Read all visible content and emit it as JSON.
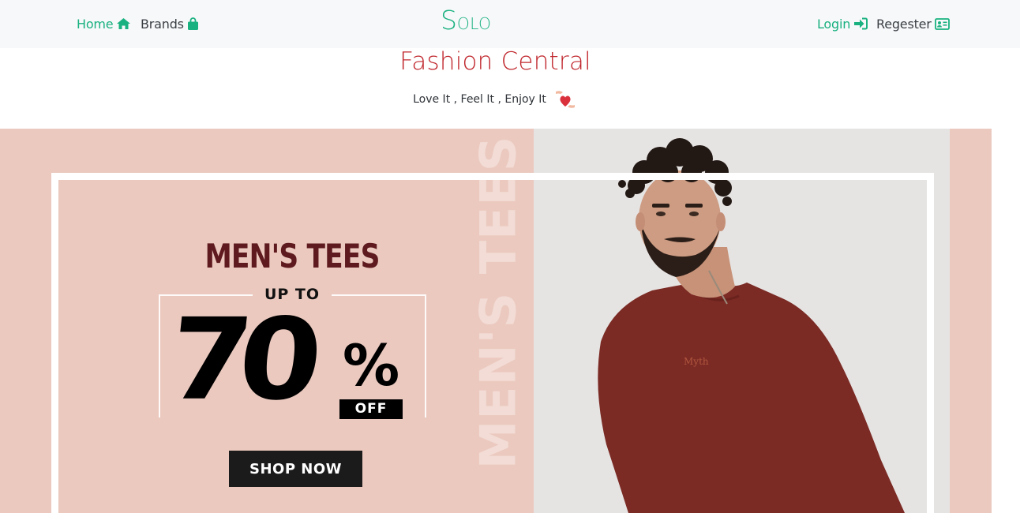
{
  "nav": {
    "home_label": "Home",
    "brands_label": "Brands",
    "logo_first": "S",
    "logo_rest": "OLO",
    "login_label": "Login",
    "register_label": "Regester"
  },
  "hero": {
    "title": "Fashion Central",
    "tagline": "Love It , Feel It , Enjoy It"
  },
  "banner": {
    "heading": "MEN'S TEES",
    "up_to": "UP TO",
    "discount_number": "70",
    "discount_symbol": "%",
    "off_label": "OFF",
    "cta": "SHOP NOW",
    "vertical_text": "MEN'S TEES",
    "shirt_print": "Myth"
  },
  "colors": {
    "accent": "#19b17f",
    "title": "#c0272d",
    "banner_bg": "#ebc9bf",
    "heading": "#5e1a1f",
    "shirt": "#7b2a24"
  },
  "icons": {
    "home": "home-icon",
    "brands": "shopping-bag-icon",
    "login": "sign-in-icon",
    "register": "id-card-icon",
    "tagline": "heart-hands-icon"
  }
}
